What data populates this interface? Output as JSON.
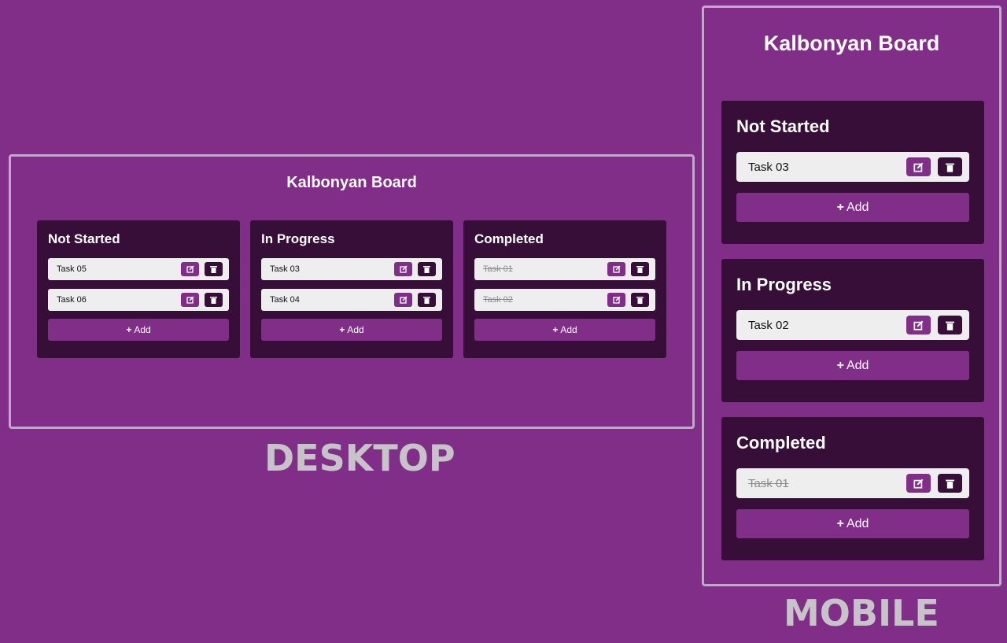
{
  "labels": {
    "desktop": "DESKTOP",
    "mobile": "MOBILE"
  },
  "desktop": {
    "title": "Kalbonyan Board",
    "columns": [
      {
        "title": "Not Started",
        "tasks": [
          "Task 05",
          "Task 06"
        ],
        "add_label": "Add"
      },
      {
        "title": "In Progress",
        "tasks": [
          "Task 03",
          "Task 04"
        ],
        "add_label": "Add"
      },
      {
        "title": "Completed",
        "tasks": [
          "Task 01",
          "Task 02"
        ],
        "add_label": "Add"
      }
    ]
  },
  "mobile": {
    "title": "Kalbonyan Board",
    "columns": [
      {
        "title": "Not Started",
        "tasks": [
          "Task 03"
        ],
        "add_label": "Add"
      },
      {
        "title": "In Progress",
        "tasks": [
          "Task 02"
        ],
        "add_label": "Add"
      },
      {
        "title": "Completed",
        "tasks": [
          "Task 01"
        ],
        "add_label": "Add"
      }
    ]
  },
  "colors": {
    "background": "#812e88",
    "column": "#370e37",
    "task": "#eeeeee",
    "frame": "#c4a7cc",
    "label": "#c6c4c8"
  },
  "icons": {
    "edit": "edit-icon",
    "delete": "trash-icon",
    "add": "plus-icon"
  }
}
